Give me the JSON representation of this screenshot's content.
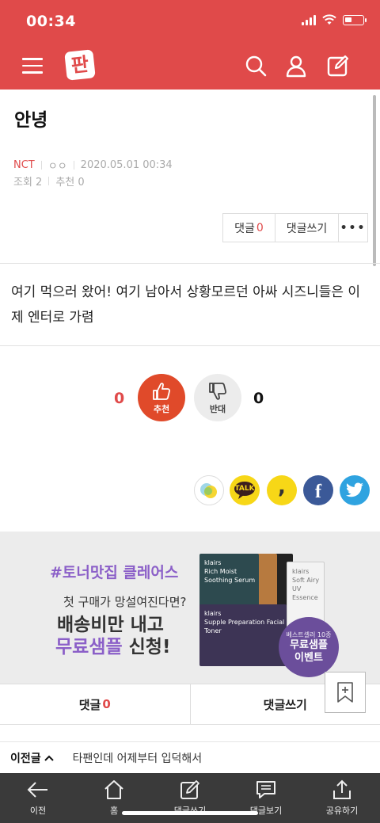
{
  "status_bar": {
    "time": "00:34"
  },
  "header": {
    "logo_text": "판"
  },
  "post": {
    "title": "안녕",
    "board": "NCT",
    "author": "ㅇㅇ",
    "datetime": "2020.05.01 00:34",
    "views": "조회 2",
    "recommends": "추천 0",
    "comment_btn_label": "댓글",
    "comment_btn_count": "0",
    "write_comment_label": "댓글쓰기",
    "more_label": "•••",
    "body": "여기 먹으러 왔어! 여기 남아서 상황모르던 아싸 시즈니들은 이제 엔터로 가렴"
  },
  "votes": {
    "up_count": "0",
    "up_label": "추천",
    "down_count": "0",
    "down_label": "반대"
  },
  "share": {
    "kakao_label": "TALK",
    "band_label": ",",
    "facebook_label": "f"
  },
  "ad": {
    "hashtag": "#토너맛집 클레어스",
    "line1": "첫 구매가 망설여진다면?",
    "line2": "배송비만 내고",
    "line3_highlight": "무료샘플",
    "line3_rest": " 신청!",
    "badge_small": "베스트셀러 10종",
    "badge_line1": "무료샘플",
    "badge_line2": "이벤트",
    "pack1_brand": "klairs",
    "pack1_name": "Rich Moist Soothing Serum",
    "pack2_brand": "klairs",
    "pack2_name": "Supple Preparation Facial Toner",
    "pack3_brand": "klairs",
    "pack3_name": "Soft Airy UV Essence"
  },
  "comment_bar": {
    "comment_label": "댓글",
    "comment_count": "0",
    "write_label": "댓글쓰기"
  },
  "prev_post": {
    "label": "이전글",
    "title": "타팬인데 어제부터 입덕해서"
  },
  "toolbar": {
    "back": "이전",
    "home": "홈",
    "write": "댓글쓰기",
    "view": "댓글보기",
    "share": "공유하기"
  },
  "colors": {
    "brand": "#e04a4a",
    "accent_purple": "#8b5fc8",
    "toolbar": "#3a3a3a"
  }
}
